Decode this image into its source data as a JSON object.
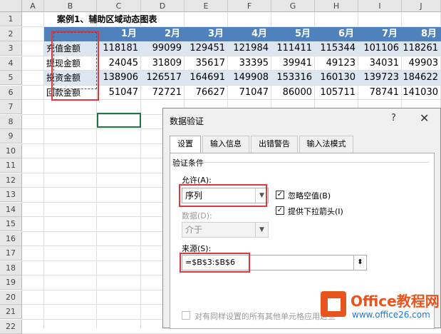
{
  "sheet": {
    "columns": [
      "A",
      "B",
      "C",
      "D",
      "E",
      "F",
      "G",
      "H",
      "I",
      "J"
    ],
    "rows": [
      "1",
      "2",
      "3",
      "4",
      "5",
      "6",
      "7",
      "8",
      "9",
      "10",
      "11",
      "12",
      "13",
      "14",
      "15",
      "16",
      "17",
      "18",
      "19",
      "20",
      "21",
      "22"
    ],
    "title": "案例1、辅助区域动态图表",
    "months": [
      "1月",
      "2月",
      "3月",
      "4月",
      "5月",
      "6月",
      "7月",
      "8月"
    ],
    "data_rows": [
      {
        "label": "充值金额",
        "values": [
          "118181",
          "99099",
          "129451",
          "121984",
          "111411",
          "115344",
          "101106",
          "118261"
        ]
      },
      {
        "label": "提现金额",
        "values": [
          "24045",
          "31809",
          "35617",
          "33395",
          "39941",
          "49123",
          "34031",
          "49903"
        ]
      },
      {
        "label": "投资金额",
        "values": [
          "138906",
          "126517",
          "164691",
          "149908",
          "153316",
          "160130",
          "139723",
          "184622"
        ]
      },
      {
        "label": "回款金额",
        "values": [
          "51047",
          "72721",
          "76627",
          "71047",
          "86000",
          "105711",
          "78741",
          "141030"
        ]
      }
    ],
    "header_color": "#4f81bd",
    "band_color": "#dce6f1"
  },
  "dialog": {
    "title": "数据验证",
    "help": "?",
    "close": "✕",
    "tabs": [
      "设置",
      "输入信息",
      "出错警告",
      "输入法模式"
    ],
    "section": "验证条件",
    "allow_label": "允许(A):",
    "allow_value": "序列",
    "ignore_blank": "忽略空值(B)",
    "dropdown_arrow": "提供下拉箭头(I)",
    "data_label": "数据(D):",
    "data_value": "介于",
    "source_label": "来源(S):",
    "source_value": "=$B$3:$B$6",
    "apply_all": "对有同样设置的所有其他单元格应用这些",
    "highlight_color": "#e0363c"
  },
  "watermark": {
    "brand": "Office教程网",
    "url": "www.office26.com"
  }
}
